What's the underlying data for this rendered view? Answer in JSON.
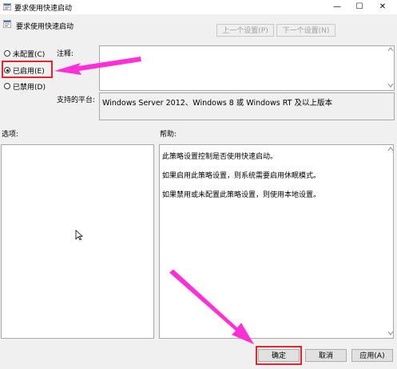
{
  "window": {
    "title": "要求使用快速启动",
    "minimize_glyph": "—",
    "maximize_glyph": "☐",
    "close_glyph": "✕"
  },
  "header": {
    "title": "要求使用快速启动",
    "prev_label": "上一个设置(P)",
    "next_label": "下一个设置(N)"
  },
  "state_options": [
    {
      "label": "未配置(C)",
      "checked": false
    },
    {
      "label": "已启用(E)",
      "checked": true
    },
    {
      "label": "已禁用(D)",
      "checked": false
    }
  ],
  "comment": {
    "label": "注释:",
    "value": ""
  },
  "supported": {
    "label": "支持的平台:",
    "value": "Windows Server 2012、Windows 8 或 Windows RT 及以上版本"
  },
  "options": {
    "label": "选项:"
  },
  "help": {
    "label": "帮助:",
    "lines": [
      "此策略设置控制是否使用快速启动。",
      "如果启用此策略设置，则系统需要启用休眠模式。",
      "如果禁用或未配置此策略设置，则使用本地设置。"
    ]
  },
  "footer": {
    "ok_label": "确定",
    "cancel_label": "取消",
    "apply_label": "应用(A)"
  },
  "colors": {
    "highlight_red": "#e8232d",
    "arrow_magenta": "#ff2fd6"
  },
  "icons": {
    "window_icon": "policy-setting-icon",
    "cursor": "mouse-pointer-icon"
  }
}
